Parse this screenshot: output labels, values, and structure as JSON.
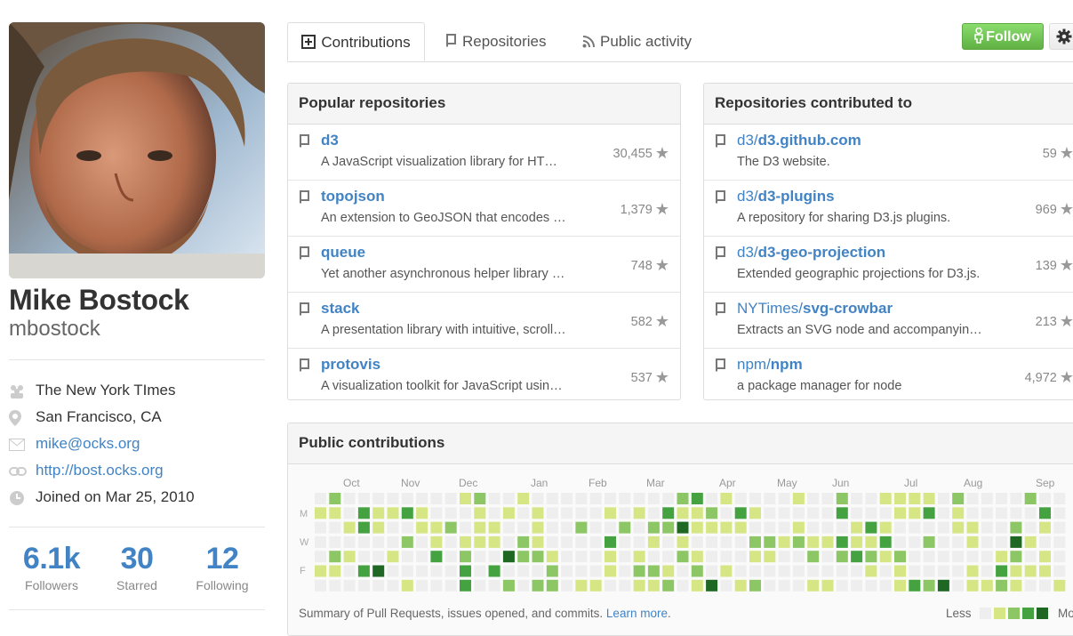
{
  "profile": {
    "full_name": "Mike Bostock",
    "username": "mbostock",
    "company": "The New York TImes",
    "location": "San Francisco, CA",
    "email": "mike@ocks.org",
    "website": "http://bost.ocks.org",
    "joined": "Joined on Mar 25, 2010"
  },
  "stats": [
    {
      "value": "6.1k",
      "label": "Followers"
    },
    {
      "value": "30",
      "label": "Starred"
    },
    {
      "value": "12",
      "label": "Following"
    }
  ],
  "tabs": [
    {
      "label": "Contributions",
      "icon": "plus-box-icon",
      "active": true
    },
    {
      "label": "Repositories",
      "icon": "repo-icon",
      "active": false
    },
    {
      "label": "Public activity",
      "icon": "rss-icon",
      "active": false
    }
  ],
  "actions": {
    "follow_label": "Follow",
    "gear_icon": "gear-icon"
  },
  "popular": {
    "title": "Popular repositories",
    "repos": [
      {
        "name": "d3",
        "description": "A JavaScript visualization library for HT…",
        "stars": "30,455"
      },
      {
        "name": "topojson",
        "description": "An extension to GeoJSON that encodes …",
        "stars": "1,379"
      },
      {
        "name": "queue",
        "description": "Yet another asynchronous helper library …",
        "stars": "748"
      },
      {
        "name": "stack",
        "description": "A presentation library with intuitive, scroll…",
        "stars": "582"
      },
      {
        "name": "protovis",
        "description": "A visualization toolkit for JavaScript usin…",
        "stars": "537"
      }
    ]
  },
  "contributed": {
    "title": "Repositories contributed to",
    "repos": [
      {
        "owner": "d3/",
        "name": "d3.github.com",
        "description": "The D3 website.",
        "stars": "59"
      },
      {
        "owner": "d3/",
        "name": "d3-plugins",
        "description": "A repository for sharing D3.js plugins.",
        "stars": "969"
      },
      {
        "owner": "d3/",
        "name": "d3-geo-projection",
        "description": "Extended geographic projections for D3.js.",
        "stars": "139"
      },
      {
        "owner": "NYTimes/",
        "name": "svg-crowbar",
        "description": "Extracts an SVG node and accompanyin…",
        "stars": "213"
      },
      {
        "owner": "npm/",
        "name": "npm",
        "description": "a package manager for node",
        "stars": "4,972"
      }
    ]
  },
  "calendar": {
    "title": "Public contributions",
    "months": [
      "Oct",
      "Nov",
      "Dec",
      "Jan",
      "Feb",
      "Mar",
      "Apr",
      "May",
      "Jun",
      "Jul",
      "Aug",
      "Sep"
    ],
    "day_labels": [
      "M",
      "W",
      "F"
    ],
    "summary": "Summary of Pull Requests, issues opened, and commits.",
    "learn_more": "Learn more",
    "legend_less": "Less",
    "legend_more": "More",
    "colors": [
      "#eeeeee",
      "#d6e685",
      "#8cc665",
      "#44a340",
      "#1e6823"
    ]
  }
}
